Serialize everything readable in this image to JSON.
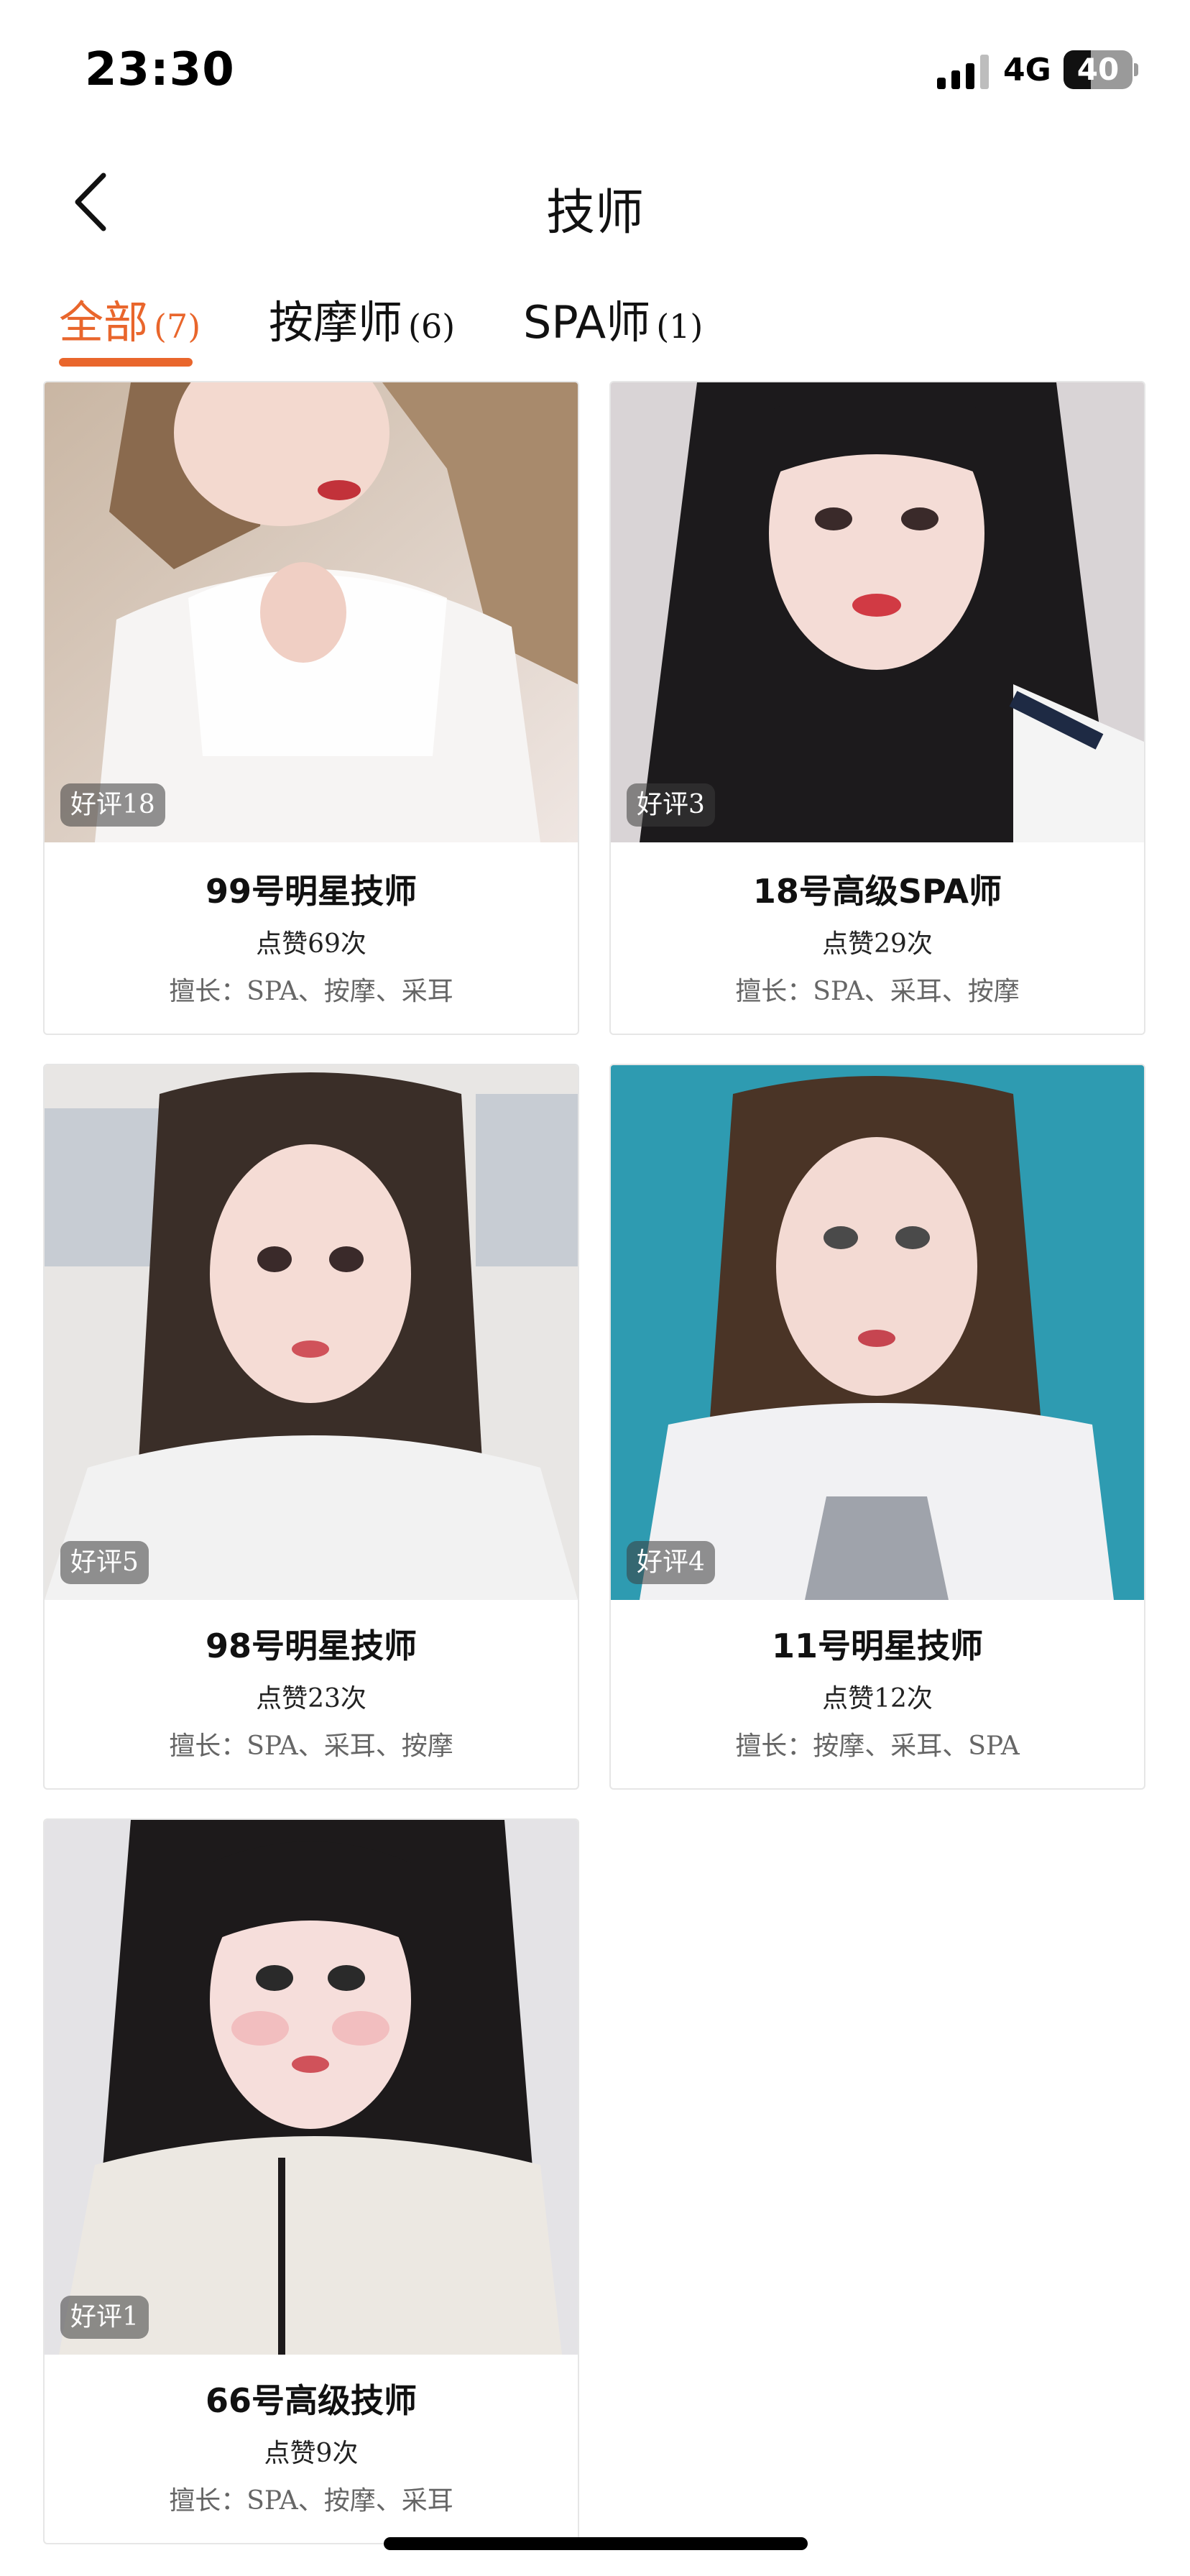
{
  "status_bar": {
    "time": "23:30",
    "network": "4G",
    "battery": "40",
    "battery_level": 0.4
  },
  "nav": {
    "title": "技师",
    "back_icon": "chevron-left-icon"
  },
  "tabs": [
    {
      "label": "全部",
      "count": "(7)",
      "active": true
    },
    {
      "label": "按摩师",
      "count": "(6)",
      "active": false
    },
    {
      "label": "SPA师",
      "count": "(1)",
      "active": false
    }
  ],
  "colors": {
    "accent": "#e9662c",
    "badge_bg": "#3c3c3c",
    "text_primary": "#111111",
    "text_secondary": "#666666"
  },
  "technicians": [
    {
      "badge": "好评18",
      "name": "99号明星技师",
      "likes": "点赞69次",
      "skills": "擅长：SPA、按摩、采耳"
    },
    {
      "badge": "好评3",
      "name": "18号高级SPA师",
      "likes": "点赞29次",
      "skills": "擅长：SPA、采耳、按摩"
    },
    {
      "badge": "好评5",
      "name": "98号明星技师",
      "likes": "点赞23次",
      "skills": "擅长：SPA、采耳、按摩"
    },
    {
      "badge": "好评4",
      "name": "11号明星技师",
      "likes": "点赞12次",
      "skills": "擅长：按摩、采耳、SPA"
    },
    {
      "badge": "好评1",
      "name": "66号高级技师",
      "likes": "点赞9次",
      "skills": "擅长：SPA、按摩、采耳"
    }
  ]
}
